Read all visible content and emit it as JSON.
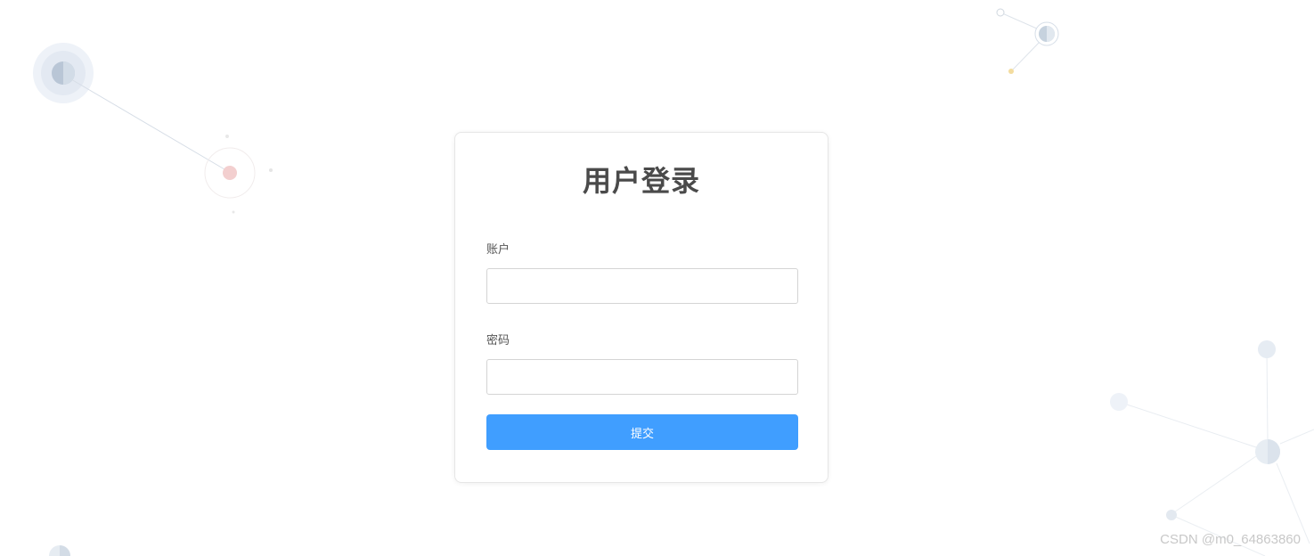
{
  "login": {
    "title": "用户登录",
    "account_label": "账户",
    "account_value": "",
    "password_label": "密码",
    "password_value": "",
    "submit_label": "提交"
  },
  "watermark": "CSDN @m0_64863860",
  "colors": {
    "accent": "#409eff",
    "title": "#4a4a4a",
    "label": "#555555",
    "border": "#d4d4d4"
  }
}
